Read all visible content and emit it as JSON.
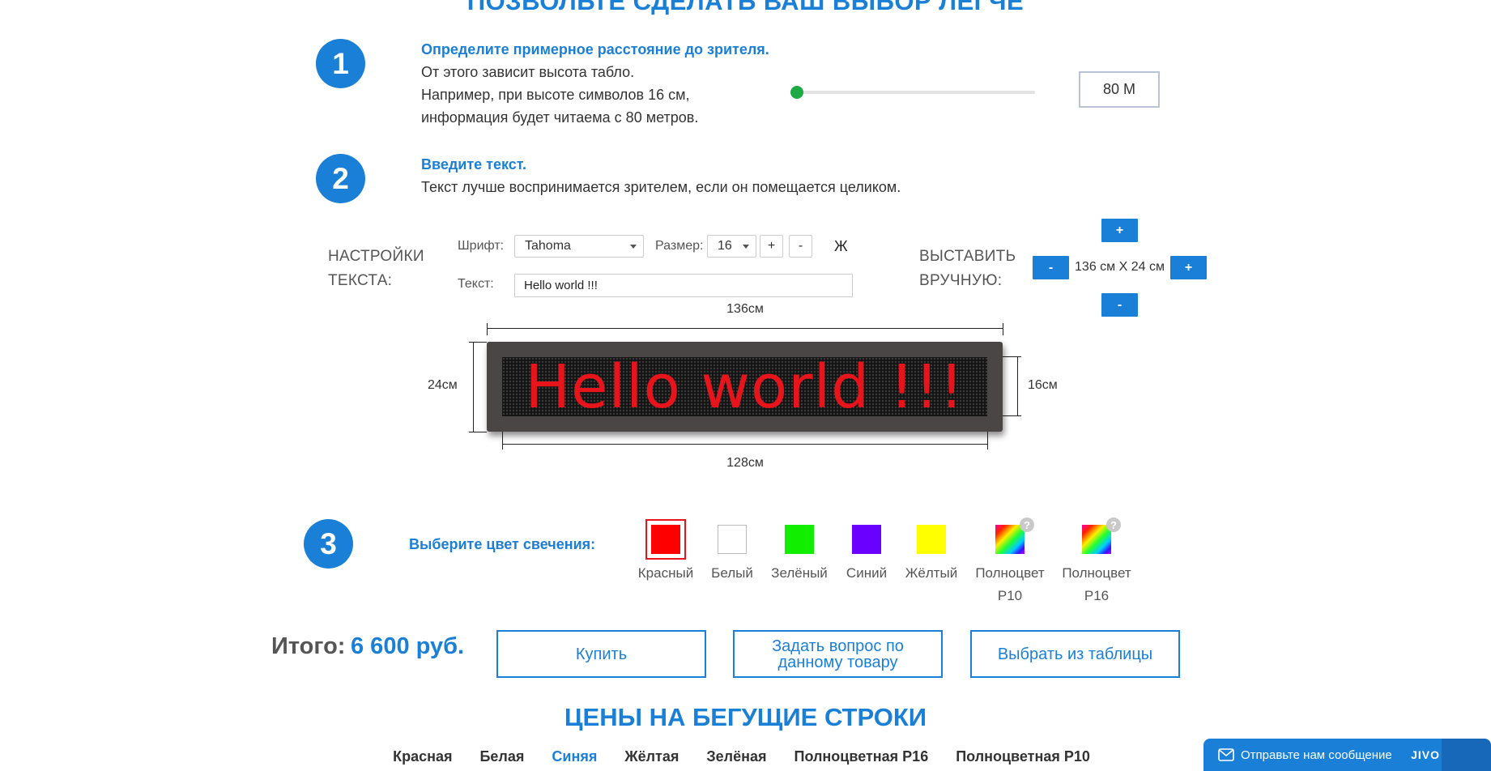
{
  "header": {
    "title": "ПОЗВОЛЬТЕ СДЕЛАТЬ ВАШ ВЫБОР ЛЕГЧЕ"
  },
  "step1": {
    "number": "1",
    "title": "Определите примерное расстояние до зрителя.",
    "lines": [
      "От этого зависит высота табло.",
      "Например, при высоте символов 16 см,",
      "информация будет читаема с 80 метров."
    ],
    "slider_fraction": 0.0,
    "distance_value": "80 М"
  },
  "step2": {
    "number": "2",
    "title": "Введите текст.",
    "description": "Текст лучше воспринимается зрителем, если он помещается целиком."
  },
  "settings": {
    "label_line1": "НАСТРОЙКИ",
    "label_line2": "ТЕКСТА:",
    "font_label": "Шрифт:",
    "font_value": "Tahoma",
    "size_label": "Размер:",
    "size_value": "16",
    "plus": "+",
    "minus": "-",
    "bold": "Ж",
    "text_label": "Текст:",
    "text_value": "Hello world !!!"
  },
  "manual": {
    "label_line1": "ВЫСТАВИТЬ",
    "label_line2": "ВРУЧНУЮ:",
    "plus": "+",
    "minus": "-",
    "size_display": "136 см X 24 см"
  },
  "preview": {
    "width_label": "136см",
    "height_label": "24см",
    "char_height_label": "16см",
    "inner_width_label": "128см",
    "display_text": "Hello world !!!",
    "led_color": "#e8141c"
  },
  "step3": {
    "number": "3",
    "title": "Выберите цвет свечения:",
    "colors": [
      {
        "line1": "Красный",
        "line2": "",
        "hex": "#ff0000",
        "selected": true,
        "help": false
      },
      {
        "line1": "Белый",
        "line2": "",
        "hex": "#ffffff",
        "selected": false,
        "help": false
      },
      {
        "line1": "Зелёный",
        "line2": "",
        "hex": "#11ee00",
        "selected": false,
        "help": false
      },
      {
        "line1": "Синий",
        "line2": "",
        "hex": "#6a00ff",
        "selected": false,
        "help": false
      },
      {
        "line1": "Жёлтый",
        "line2": "",
        "hex": "#ffff00",
        "selected": false,
        "help": false
      },
      {
        "line1": "Полноцвет",
        "line2": "P10",
        "hex": "multicolor",
        "selected": false,
        "help": true
      },
      {
        "line1": "Полноцвет",
        "line2": "P16",
        "hex": "multicolor",
        "selected": false,
        "help": true
      }
    ],
    "help_symbol": "?"
  },
  "total": {
    "label": "Итого:",
    "price": "6 600 руб."
  },
  "actions": {
    "buy": "Купить",
    "ask_line1": "Задать вопрос по",
    "ask_line2": "данному товару",
    "choose": "Выбрать из таблицы"
  },
  "prices": {
    "title": "ЦЕНЫ НА БЕГУЩИЕ СТРОКИ",
    "tabs": [
      {
        "label": "Красная",
        "active": false
      },
      {
        "label": "Белая",
        "active": false
      },
      {
        "label": "Синяя",
        "active": true
      },
      {
        "label": "Жёлтая",
        "active": false
      },
      {
        "label": "Зелёная",
        "active": false
      },
      {
        "label": "Полноцветная P16",
        "active": false
      },
      {
        "label": "Полноцветная P10",
        "active": false
      }
    ]
  },
  "chat": {
    "text": "Отправьте нам сообщение",
    "brand": "JIVO"
  },
  "colors": {
    "accent": "#1a7fd6",
    "led_red": "#e8141c",
    "slider_green": "#1ea944"
  }
}
